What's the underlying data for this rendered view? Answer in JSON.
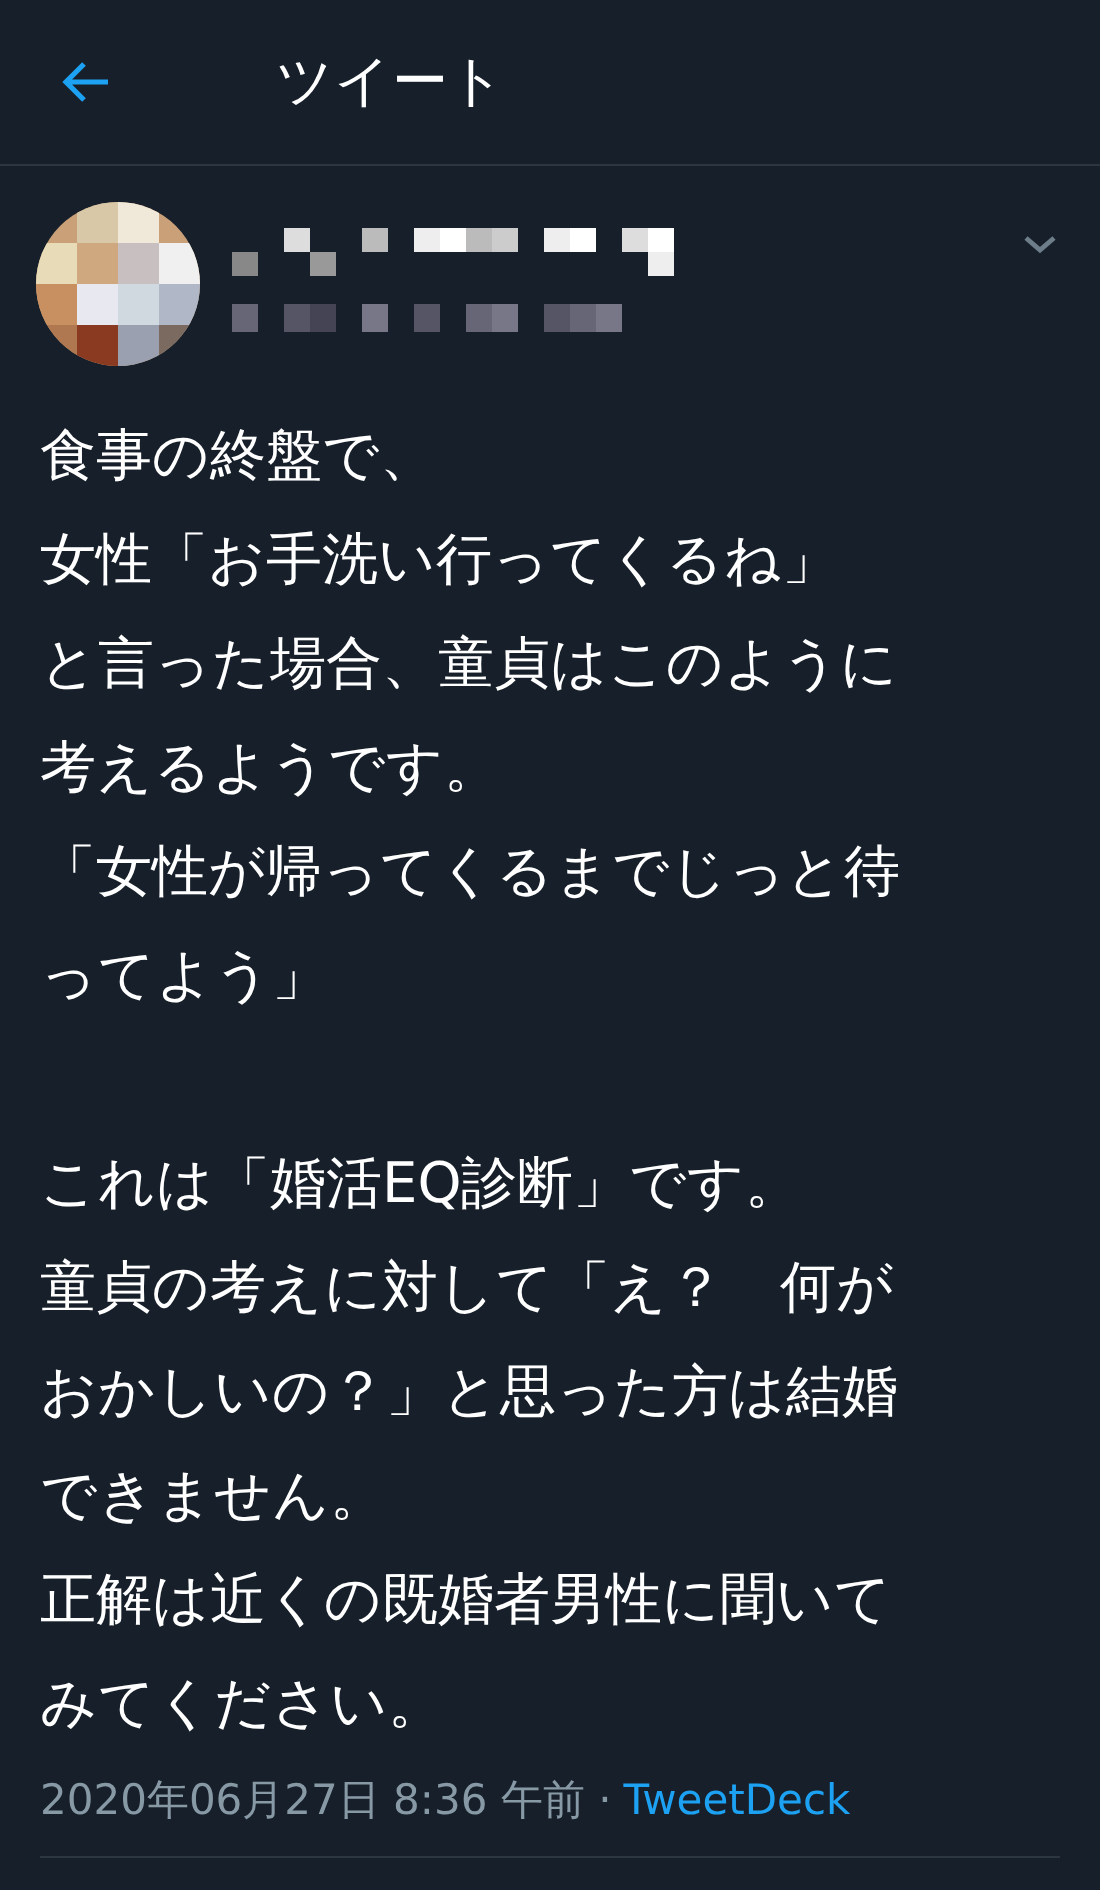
{
  "header": {
    "title": "ツイート"
  },
  "tweet": {
    "paragraphs": [
      [
        "食事の終盤で、",
        "女性「お手洗い行ってくるね」",
        "と言った場合、童貞はこのように",
        "考えるようです。",
        "「女性が帰ってくるまでじっと待",
        "ってよう」"
      ],
      [
        "これは「婚活EQ診断」です。",
        "童貞の考えに対して「え？　何が",
        "おかしいの？」と思った方は結婚",
        "できません。",
        "正解は近くの既婚者男性に聞いて",
        "みてください。"
      ]
    ],
    "timestamp": "2020年06月27日 8:36 午前 ·",
    "source": "TweetDeck"
  }
}
